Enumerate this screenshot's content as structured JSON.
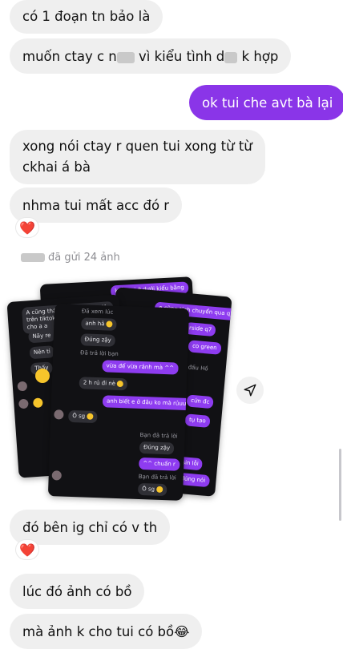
{
  "messages": [
    {
      "id": "m1",
      "text": "có 1 đoạn tn bảo là"
    },
    {
      "id": "m2",
      "pre": "muốn ctay c n",
      "mid": " vì kiểu tình d",
      "post": " k hợp"
    },
    {
      "id": "m3",
      "text": "ok tui che avt bà lại"
    },
    {
      "id": "m4a",
      "text": "xong nói ctay r quen tui xong từ từ"
    },
    {
      "id": "m4b",
      "text": "ckhai á bà"
    },
    {
      "id": "m5",
      "text": "nhma tui mất acc đó r"
    },
    {
      "id": "m6",
      "text": "đó bên ig chỉ có v th"
    },
    {
      "id": "m7",
      "text": "lúc đó ảnh có bồ"
    },
    {
      "id": "m8",
      "text": "mà ảnh k cho tui có bồ"
    }
  ],
  "reaction_heart": "❤️",
  "laugh_emoji": "😂",
  "sent_note": "đã gửi 24 ảnh",
  "photo_stack": {
    "front_texts": {
      "seen1": "Đã xem lúc",
      "anh_ha": "anh hả",
      "dung_zay": "Đúng zậy",
      "seen2": "Đã trả lời bạn",
      "vua_de": "vừa để vừa rảnh mà ^^",
      "2h": "2 h rủ đi nè",
      "anh_biet": "anh biết e ở đâu ko mà rủuuu",
      "o_sg": "Ô sg",
      "seen3": "Bạn đã trả lời",
      "dung_zay2": "Đúng zậy",
      "chuan": "^^ chuẩn r",
      "seen4": "Bạn đã trả lời",
      "o_sg2": "Ô sg"
    },
    "back_left_texts": [
      "A cũng thấy",
      "cho a a",
      "Nãy re",
      "Nên ti",
      "Thấy"
    ],
    "back_left_header": "hay nói rằng giả trên tiktok",
    "back_right_texts": [
      "e cũng tính chuyển qua q7",
      "rside q7",
      "co green",
      "đấu Hồ",
      "cứn đc",
      "tụ tạo",
      "sin lỗi",
      "đúng nói"
    ],
    "back_top_text": "kiểu tui ở dưới kiểu bằng"
  },
  "share_icon": "send-icon",
  "colors": {
    "outgoing": "#8a35e8",
    "incoming": "#efefef"
  }
}
